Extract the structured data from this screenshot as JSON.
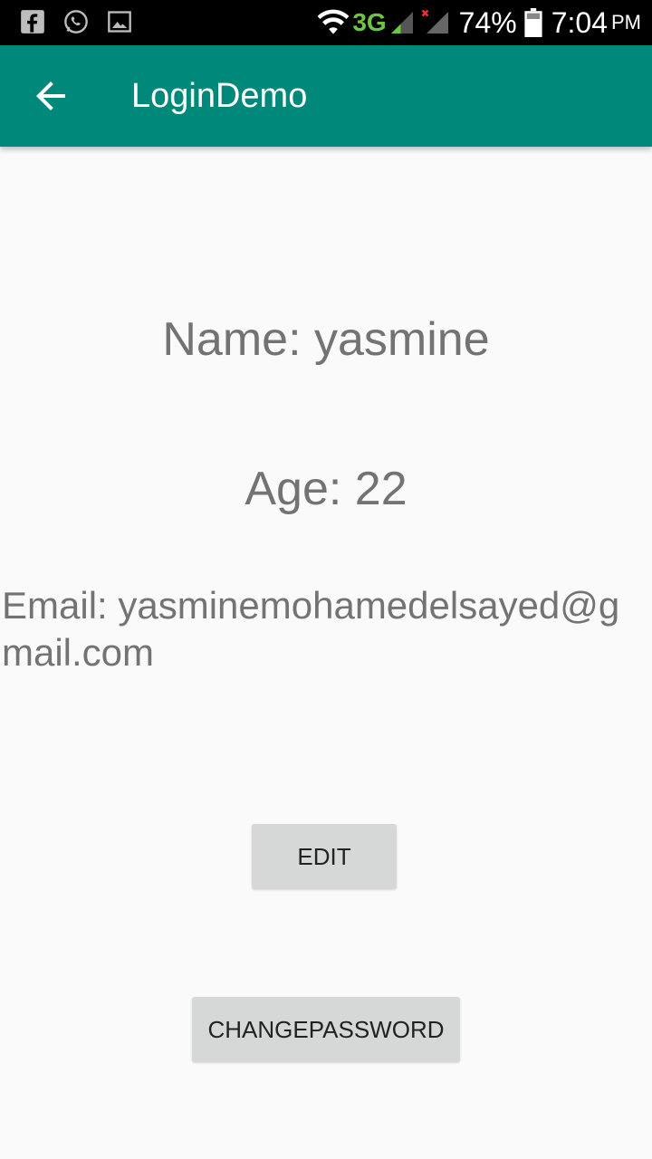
{
  "status_bar": {
    "network": "3G",
    "battery": "74%",
    "time": "7:04",
    "ampm": "PM",
    "icons": [
      "facebook-icon",
      "whatsapp-icon",
      "gallery-icon",
      "wifi-icon",
      "signal-icon",
      "signal-no-service-icon",
      "battery-icon"
    ]
  },
  "app_bar": {
    "title": "LoginDemo",
    "color": "#00897b"
  },
  "profile": {
    "name": "Name: yasmine",
    "age": "Age: 22",
    "email": "Email: yasminemohamedelsayed@gmail.com"
  },
  "buttons": {
    "edit": "EDIT",
    "change_password": "CHANGEPASSWORD"
  }
}
